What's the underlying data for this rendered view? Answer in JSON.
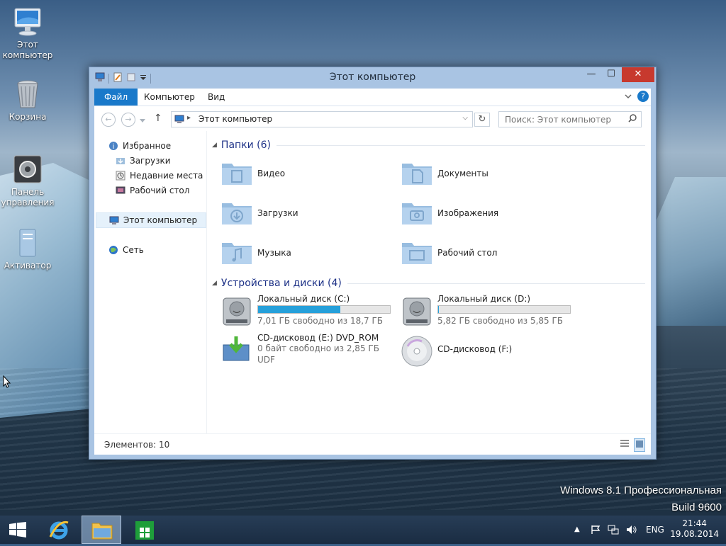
{
  "desktop": {
    "icons": [
      {
        "label_line1": "Этот",
        "label_line2": "компьютер"
      },
      {
        "label_line1": "Корзина",
        "label_line2": ""
      },
      {
        "label_line1": "Панель",
        "label_line2": "управления"
      },
      {
        "label_line1": "Активатор",
        "label_line2": ""
      }
    ],
    "watermark_line1": "Windows 8.1 Профессиональная",
    "watermark_line2": "Build 9600"
  },
  "window": {
    "title": "Этот компьютер",
    "controls": {
      "minimize": "—",
      "maximize": "☐",
      "close": "✕"
    },
    "ribbon_tabs": [
      "Файл",
      "Компьютер",
      "Вид"
    ],
    "address": "Этот компьютер",
    "search_placeholder": "Поиск: Этот компьютер",
    "nav_pane": {
      "favorites": "Избранное",
      "favorites_items": [
        "Загрузки",
        "Недавние места",
        "Рабочий стол"
      ],
      "this_pc": "Этот компьютер",
      "network": "Сеть"
    },
    "folders_group": "Папки (6)",
    "folders": [
      "Видео",
      "Документы",
      "Загрузки",
      "Изображения",
      "Музыка",
      "Рабочий стол"
    ],
    "devices_group": "Устройства и диски (4)",
    "drives": [
      {
        "name": "Локальный диск (C:)",
        "info": "7,01 ГБ свободно из 18,7 ГБ",
        "used_fraction": 0.625
      },
      {
        "name": "Локальный диск (D:)",
        "info": "5,82 ГБ свободно из 5,85 ГБ",
        "used_fraction": 0.005
      },
      {
        "name": "CD-дисковод (E:) DVD_ROM",
        "info": "0 байт свободно из 2,85 ГБ",
        "fs": "UDF"
      },
      {
        "name": "CD-дисковод (F:)"
      }
    ],
    "status": "Элементов: 10"
  },
  "taskbar": {
    "language": "ENG",
    "time": "21:44",
    "date": "19.08.2014"
  },
  "colors": {
    "accent": "#1979ca",
    "close": "#c7392e",
    "disk_bar": "#26a0da",
    "group_header": "#1e3287"
  }
}
